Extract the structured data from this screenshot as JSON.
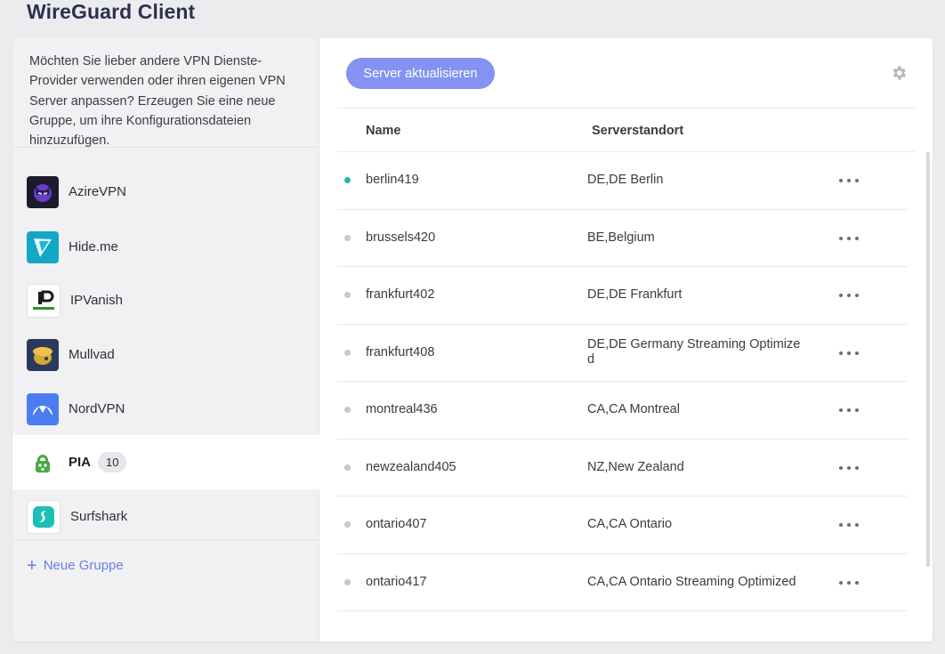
{
  "app": {
    "title": "WireGuard Client"
  },
  "sidebar": {
    "info": "Möchten Sie lieber andere VPN Dienste-Provider verwenden oder ihren eigenen VPN Server anpassen? Erzeugen Sie eine neue Gruppe, um ihre Konfigurationsdateien hinzuzufügen.",
    "providers": [
      {
        "label": "AzireVPN",
        "icon": "azirevpn-logo-icon",
        "color": "#1b1b2e"
      },
      {
        "label": "Hide.me",
        "icon": "hideme-logo-icon",
        "color": "#14a6c7"
      },
      {
        "label": "IPVanish",
        "icon": "ipvanish-logo-icon",
        "color": "#ffffff"
      },
      {
        "label": "Mullvad",
        "icon": "mullvad-logo-icon",
        "color": "#2a3a5c"
      },
      {
        "label": "NordVPN",
        "icon": "nordvpn-logo-icon",
        "color": "#4b7cf2"
      },
      {
        "label": "PIA",
        "icon": "pia-logo-icon",
        "color": "#4ca842",
        "count": "10",
        "active": true
      },
      {
        "label": "Surfshark",
        "icon": "surfshark-logo-icon",
        "color": "#1cbfb4"
      }
    ],
    "new_group": "Neue Gruppe"
  },
  "main": {
    "refresh_label": "Server aktualisieren",
    "columns": {
      "name": "Name",
      "location": "Serverstandort"
    },
    "rows": [
      {
        "name": "berlin419",
        "location": "DE,DE Berlin",
        "connected": true
      },
      {
        "name": "brussels420",
        "location": "BE,Belgium",
        "connected": false
      },
      {
        "name": "frankfurt402",
        "location": "DE,DE Frankfurt",
        "connected": false
      },
      {
        "name": "frankfurt408",
        "location": "DE,DE Germany Streaming Optimize d",
        "connected": false
      },
      {
        "name": "montreal436",
        "location": "CA,CA Montreal",
        "connected": false
      },
      {
        "name": "newzealand405",
        "location": "NZ,New Zealand",
        "connected": false
      },
      {
        "name": "ontario407",
        "location": "CA,CA Ontario",
        "connected": false
      },
      {
        "name": "ontario417",
        "location": "CA,CA Ontario Streaming Optimized",
        "connected": false
      }
    ]
  },
  "colors": {
    "accent": "#8493f1",
    "connected": "#21b8a6",
    "link": "#6a7eec"
  }
}
